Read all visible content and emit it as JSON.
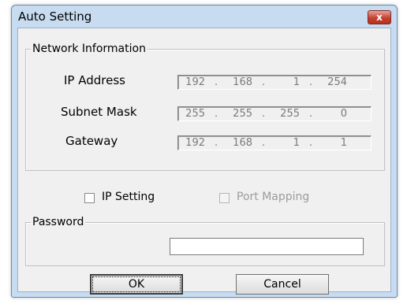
{
  "window": {
    "title": "Auto Setting",
    "close_glyph": "x"
  },
  "network": {
    "group_label": "Network Information",
    "ip_address": {
      "label": "IP Address",
      "octets": [
        "192",
        "168",
        "1",
        "254"
      ]
    },
    "subnet_mask": {
      "label": "Subnet Mask",
      "octets": [
        "255",
        "255",
        "255",
        "0"
      ]
    },
    "gateway": {
      "label": "Gateway",
      "octets": [
        "192",
        "168",
        "1",
        "1"
      ]
    },
    "separator": "."
  },
  "options": {
    "ip_setting": {
      "label": "IP Setting",
      "checked": false,
      "enabled": true
    },
    "port_mapping": {
      "label": "Port Mapping",
      "checked": false,
      "enabled": false
    }
  },
  "password": {
    "group_label": "Password",
    "value": ""
  },
  "buttons": {
    "ok": "OK",
    "cancel": "Cancel"
  }
}
